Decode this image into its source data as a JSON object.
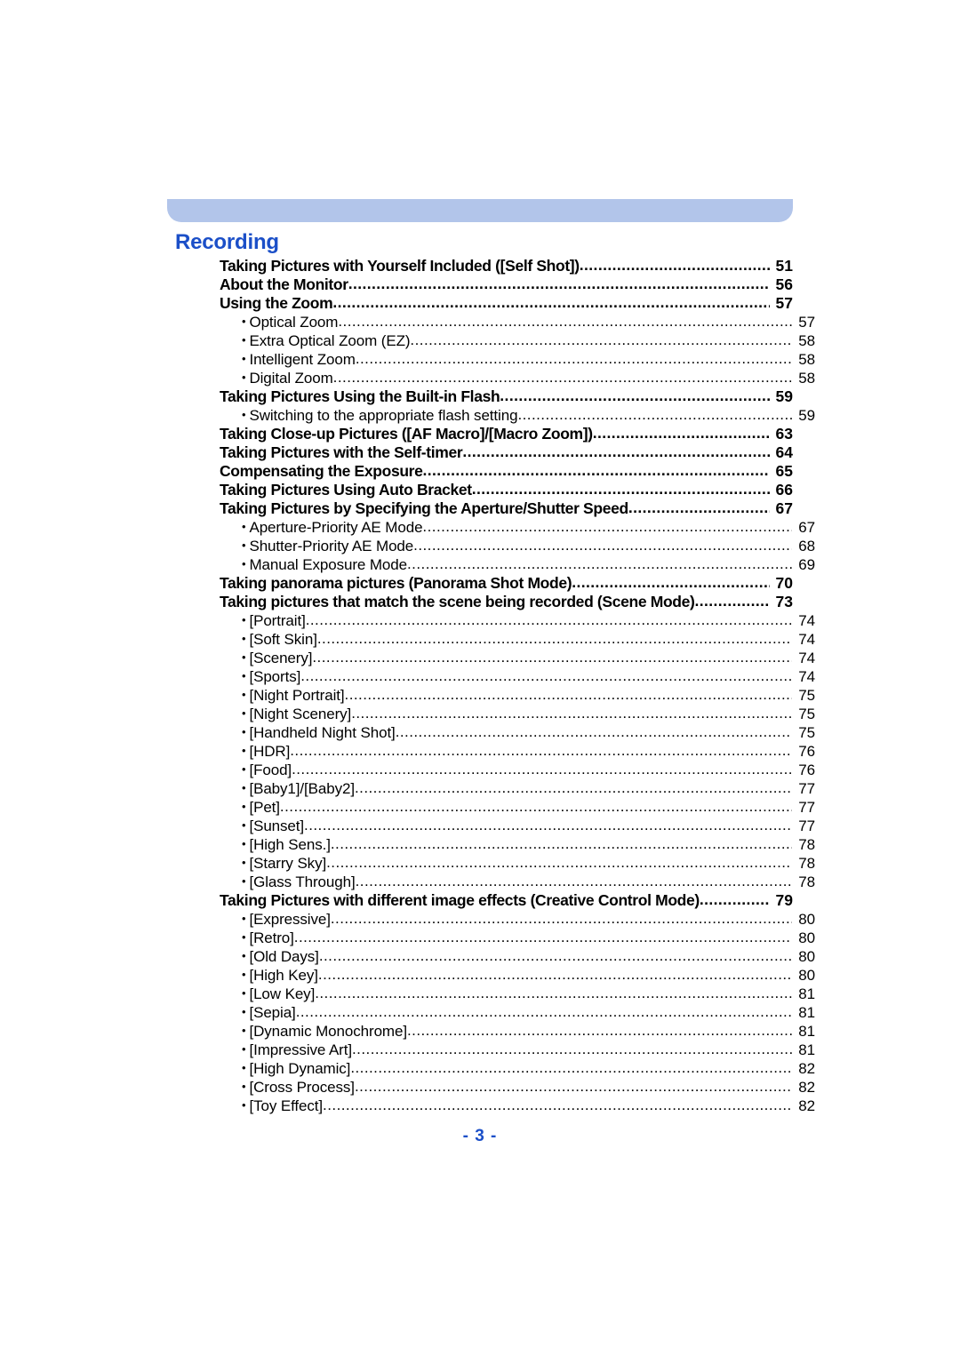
{
  "document": {
    "section_title": "Recording",
    "footer_page_label": "- 3 -",
    "accent_color": "#1b4fc8",
    "band_color": "#b2c5ea",
    "leader_dots": "...................................................................................................................................................................."
  },
  "toc": {
    "entries": [
      {
        "level": 1,
        "label": "Taking Pictures with Yourself Included ([Self Shot])",
        "page": "51"
      },
      {
        "level": 1,
        "label": "About the Monitor",
        "page": "56"
      },
      {
        "level": 1,
        "label": "Using the Zoom",
        "page": "57"
      },
      {
        "level": 2,
        "label": "Optical Zoom",
        "page": "57"
      },
      {
        "level": 2,
        "label": "Extra Optical Zoom (EZ)",
        "page": "58"
      },
      {
        "level": 2,
        "label": "Intelligent Zoom",
        "page": "58"
      },
      {
        "level": 2,
        "label": "Digital Zoom",
        "page": "58"
      },
      {
        "level": 1,
        "label": "Taking Pictures Using the Built-in Flash",
        "page": "59"
      },
      {
        "level": 2,
        "label": "Switching to the appropriate flash setting",
        "page": "59"
      },
      {
        "level": 1,
        "label": "Taking Close-up Pictures ([AF Macro]/[Macro Zoom])",
        "page": "63"
      },
      {
        "level": 1,
        "label": "Taking Pictures with the Self-timer",
        "page": "64"
      },
      {
        "level": 1,
        "label": "Compensating the Exposure",
        "page": "65"
      },
      {
        "level": 1,
        "label": "Taking Pictures Using Auto Bracket",
        "page": "66"
      },
      {
        "level": 1,
        "label": "Taking Pictures by Specifying the Aperture/Shutter Speed",
        "page": "67"
      },
      {
        "level": 2,
        "label": "Aperture-Priority AE Mode",
        "page": "67"
      },
      {
        "level": 2,
        "label": "Shutter-Priority AE Mode",
        "page": "68"
      },
      {
        "level": 2,
        "label": "Manual Exposure Mode",
        "page": "69"
      },
      {
        "level": 1,
        "label": "Taking panorama pictures (Panorama Shot Mode)",
        "page": "70"
      },
      {
        "level": 1,
        "label": "Taking pictures that match the scene being recorded (Scene Mode)",
        "page": "73"
      },
      {
        "level": 2,
        "label": "[Portrait]",
        "page": "74"
      },
      {
        "level": 2,
        "label": "[Soft Skin]",
        "page": "74"
      },
      {
        "level": 2,
        "label": "[Scenery]",
        "page": "74"
      },
      {
        "level": 2,
        "label": "[Sports]",
        "page": "74"
      },
      {
        "level": 2,
        "label": "[Night Portrait]",
        "page": "75"
      },
      {
        "level": 2,
        "label": "[Night Scenery]",
        "page": "75"
      },
      {
        "level": 2,
        "label": "[Handheld Night Shot]",
        "page": "75"
      },
      {
        "level": 2,
        "label": "[HDR]",
        "page": "76"
      },
      {
        "level": 2,
        "label": "[Food]",
        "page": "76"
      },
      {
        "level": 2,
        "label": "[Baby1]/[Baby2]",
        "page": "77"
      },
      {
        "level": 2,
        "label": "[Pet]",
        "page": "77"
      },
      {
        "level": 2,
        "label": "[Sunset]",
        "page": "77"
      },
      {
        "level": 2,
        "label": "[High Sens.]",
        "page": "78"
      },
      {
        "level": 2,
        "label": "[Starry Sky]",
        "page": "78"
      },
      {
        "level": 2,
        "label": "[Glass Through]",
        "page": "78"
      },
      {
        "level": 1,
        "label": "Taking Pictures with different image effects (Creative Control Mode)",
        "page": "79"
      },
      {
        "level": 2,
        "label": "[Expressive]",
        "page": "80"
      },
      {
        "level": 2,
        "label": "[Retro]",
        "page": "80"
      },
      {
        "level": 2,
        "label": "[Old Days]",
        "page": "80"
      },
      {
        "level": 2,
        "label": "[High Key]",
        "page": "80"
      },
      {
        "level": 2,
        "label": "[Low Key]",
        "page": "81"
      },
      {
        "level": 2,
        "label": "[Sepia]",
        "page": "81"
      },
      {
        "level": 2,
        "label": "[Dynamic Monochrome]",
        "page": "81"
      },
      {
        "level": 2,
        "label": "[Impressive Art]",
        "page": "81"
      },
      {
        "level": 2,
        "label": "[High Dynamic]",
        "page": "82"
      },
      {
        "level": 2,
        "label": "[Cross Process]",
        "page": "82"
      },
      {
        "level": 2,
        "label": "[Toy Effect]",
        "page": "82"
      }
    ]
  }
}
